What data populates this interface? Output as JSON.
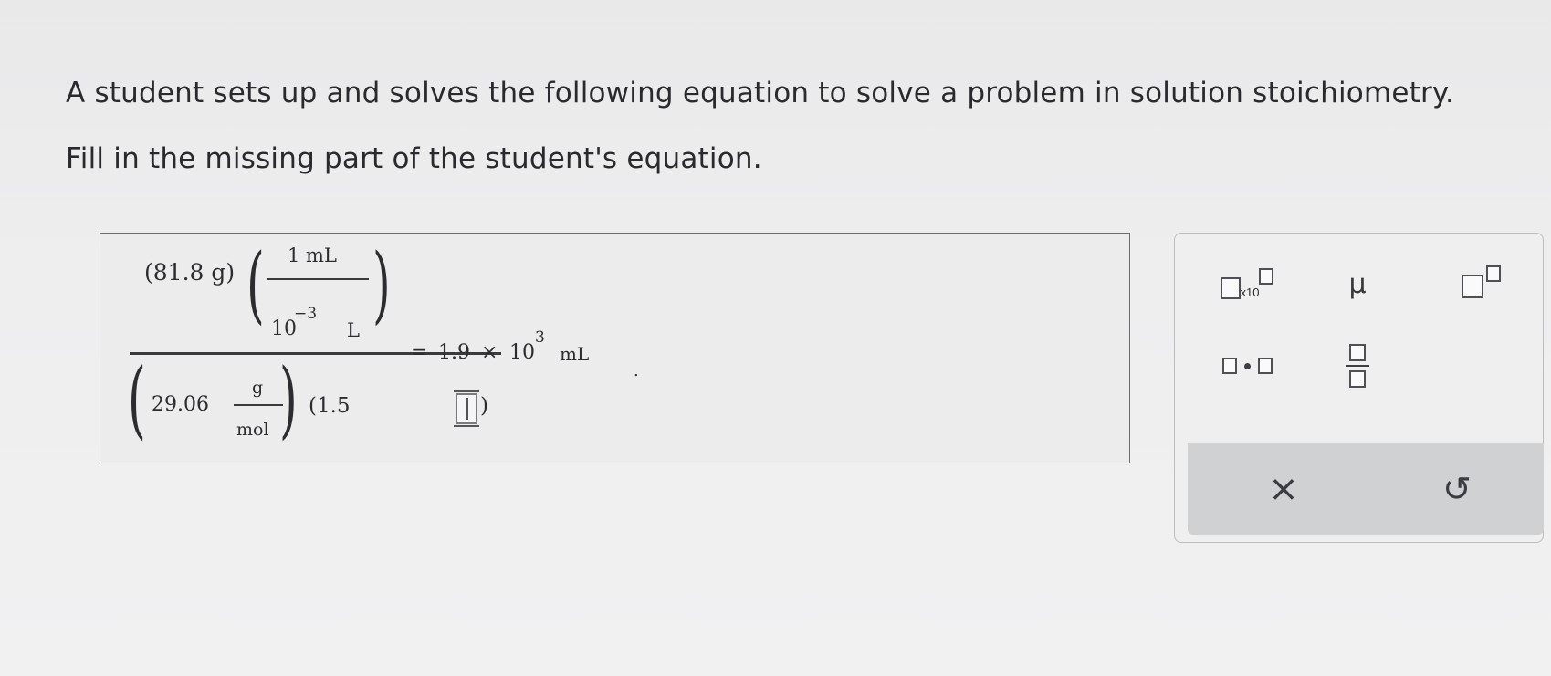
{
  "prompt": {
    "line1": "A student sets up and solves the following equation to solve a problem in solution stoichiometry.",
    "line2": "Fill in the missing part of the student's equation."
  },
  "equation": {
    "mass": "(81.8 g)",
    "conv_num": "1 mL",
    "conv_den_base": "10",
    "conv_den_exp": "−3",
    "conv_den_unit": "L",
    "molar_mass_value": "29.06",
    "molar_mass_num": "g",
    "molar_mass_den": "mol",
    "second_factor_open": "(1.5",
    "second_factor_close": ")",
    "equals": "=",
    "result_coeff": "1.9",
    "times": "×",
    "result_base": "10",
    "result_exp": "3",
    "result_unit": "mL",
    "period": "."
  },
  "palette": {
    "sci_notation_label": "x10",
    "mu_symbol": "μ",
    "clear_symbol": "×",
    "undo_symbol": "↺"
  }
}
